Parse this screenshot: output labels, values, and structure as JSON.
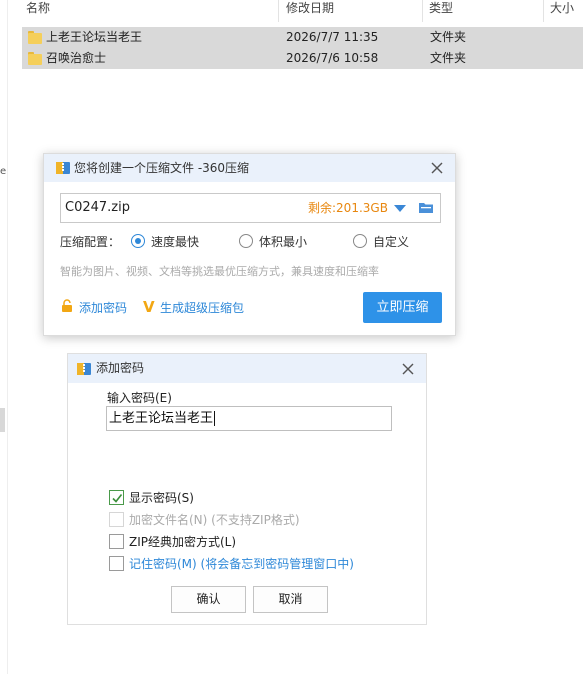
{
  "explorer": {
    "columns": [
      "名称",
      "修改日期",
      "类型",
      "大小"
    ],
    "rows": [
      {
        "name": "上老王论坛当老王",
        "date": "2026/7/7 11:35",
        "type": "文件夹"
      },
      {
        "name": "召唤治愈士",
        "date": "2026/7/6 10:58",
        "type": "文件夹"
      }
    ],
    "edge_glyph": "e"
  },
  "compress_dialog": {
    "title": "您将创建一个压缩文件 -360压缩",
    "file_name": "C0247.zip",
    "free_space": "剩余:201.3GB",
    "config_label": "压缩配置：",
    "options": [
      "速度最快",
      "体积最小",
      "自定义"
    ],
    "selected_option": "速度最快",
    "hint": "智能为图片、视频、文档等挑选最优压缩方式，兼具速度和压缩率",
    "add_password": "添加密码",
    "super_package": "生成超级压缩包",
    "compress_button": "立即压缩"
  },
  "password_dialog": {
    "title": "添加密码",
    "input_label": "输入密码(E)",
    "password_value": "上老王论坛当老王",
    "show_password": {
      "label": "显示密码(S)",
      "checked": true
    },
    "encrypt_filenames": {
      "label": "加密文件名(N) (不支持ZIP格式)",
      "checked": false,
      "disabled": true
    },
    "zip_classic": {
      "label": "ZIP经典加密方式(L)",
      "checked": false
    },
    "remember_password": {
      "label": "记住密码(M) (将会备忘到密码管理窗口中)",
      "checked": false
    },
    "ok_button": "确认",
    "cancel_button": "取消"
  },
  "colors": {
    "accent_blue": "#2e92e8",
    "free_space_orange": "#e8870f",
    "titlebar": "#eaf1fb",
    "selected_row": "#d9d9d9"
  }
}
